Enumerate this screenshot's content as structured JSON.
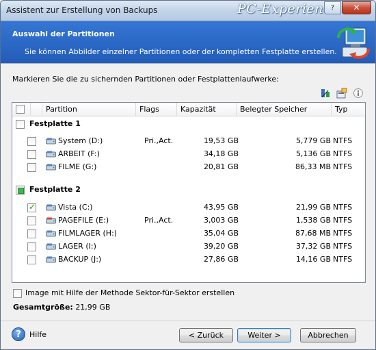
{
  "window": {
    "title": "Assistent zur Erstellung von Backups",
    "watermark": "PC-Experience",
    "close_label": "✕",
    "help_label": "?"
  },
  "header": {
    "title": "Auswahl der Partitionen",
    "subtitle": "Sie können Abbilder einzelner Partitionen oder der kompletten Festplatte erstellen."
  },
  "instruction": "Markieren Sie die zu sichernden Partitionen oder Festplattenlaufwerke:",
  "table": {
    "columns": [
      "Partition",
      "Flags",
      "Kapazität",
      "Belegter Speicher",
      "Typ"
    ],
    "groups": [
      {
        "label": "Festplatte 1",
        "state": "unchecked",
        "rows": [
          {
            "name": "System (D:)",
            "flags": "Pri.,Act.",
            "capacity": "19,53 GB",
            "used": "5,779 GB",
            "type": "NTFS",
            "checked": false
          },
          {
            "name": "ARBEIT (F:)",
            "flags": "",
            "capacity": "34,18 GB",
            "used": "5,136 GB",
            "type": "NTFS",
            "checked": false
          },
          {
            "name": "FILME (G:)",
            "flags": "",
            "capacity": "20,81 GB",
            "used": "86,33 MB",
            "type": "NTFS",
            "checked": false
          }
        ]
      },
      {
        "label": "Festplatte 2",
        "state": "partial",
        "rows": [
          {
            "name": "Vista (C:)",
            "flags": "",
            "capacity": "43,95 GB",
            "used": "21,99 GB",
            "type": "NTFS",
            "checked": true
          },
          {
            "name": "PAGEFILE (E:)",
            "flags": "Pri.,Act.",
            "capacity": "3,003 GB",
            "used": "1,538 GB",
            "type": "NTFS",
            "checked": false
          },
          {
            "name": "FILMLAGER (H:)",
            "flags": "",
            "capacity": "35,04 GB",
            "used": "87,68 MB",
            "type": "NTFS",
            "checked": false
          },
          {
            "name": "LAGER (I:)",
            "flags": "",
            "capacity": "39,20 GB",
            "used": "37,32 GB",
            "type": "NTFS",
            "checked": false
          },
          {
            "name": "BACKUP (J:)",
            "flags": "",
            "capacity": "27,86 GB",
            "used": "14,16 GB",
            "type": "NTFS",
            "checked": false
          }
        ]
      }
    ]
  },
  "sector_option": {
    "label": "Image mit Hilfe der Methode Sektor-für-Sektor erstellen",
    "checked": false
  },
  "total": {
    "label": "Gesamtgröße:",
    "value": "21,99 GB"
  },
  "footer": {
    "help": "Hilfe",
    "back": "< Zurück",
    "next": "Weiter >",
    "cancel": "Abbrechen"
  },
  "colors": {
    "header_blue": "#2b6aca",
    "check_green": "#21a121"
  },
  "icons": {
    "toolbar": [
      "sort-icon",
      "properties-icon",
      "info-icon"
    ],
    "partition": "hard-disk-icon",
    "header": "backup-computer-icon"
  }
}
